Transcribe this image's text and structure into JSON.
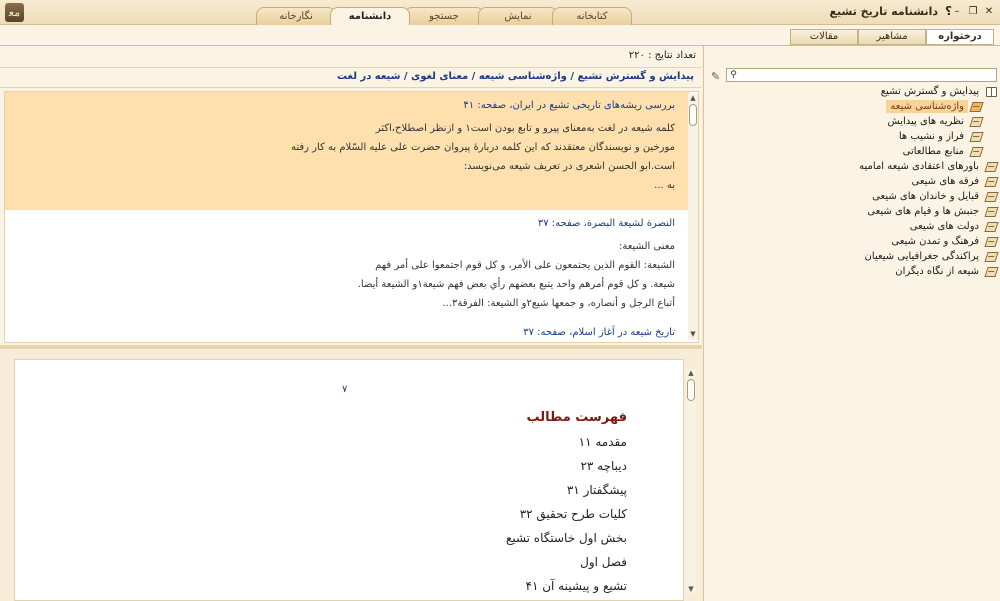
{
  "window": {
    "title": "دانشنامه تاریخ تشیع",
    "help": "؟",
    "minimize": "–",
    "restore": "❐",
    "close": "✕",
    "logo": "ﻣﻌ"
  },
  "main_tabs": [
    {
      "label": "کتابخانه",
      "active": false
    },
    {
      "label": "نمایش",
      "active": false
    },
    {
      "label": "جستجو",
      "active": false
    },
    {
      "label": "دانشنامه",
      "active": true
    },
    {
      "label": "نگارخانه",
      "active": false
    }
  ],
  "side_tabs": [
    {
      "label": "درختواره",
      "active": true
    },
    {
      "label": "مشاهیر",
      "active": false
    },
    {
      "label": "مقالات",
      "active": false
    }
  ],
  "result_count": "تعداد نتایج : ۲۲۰",
  "breadcrumb": "پیدایش و گسترش تشیع / واژه‌شناسی شیعه / معنای لغوی / شیعه در لغت",
  "results": [
    {
      "title": "بررسی ریشه‌های تاریخی تشیع در ایران، صفحه: ۴۱",
      "highlighted": true,
      "lines": [
        "کلمه شیعه در لغت به‌معنای پیرو و تابع بودن است۱ و ازنظر اصطلاح،اکثر",
        "مورخین و نویسندگان معتقدند که این کلمه دربارهٔ پیروان حضرت علی علیه السّلام به کار رفته",
        "است.ابو الحسن اشعری در تعریف شیعه می‌نویسد:",
        "به ..."
      ]
    },
    {
      "title": "النصرة لشیعة البصرة، صفحه: ۳۷",
      "highlighted": false,
      "lines": [
        "معنی الشیعة:",
        "الشیعة: القوم الذین یجتمعون علی الأمر، و کل قوم اجتمعوا علی أمر فهم",
        "شیعة. و کل قوم أمرهم واحد یتبع بعضهم رأي بعض فهم شیعة۱و الشیعة أیضا.",
        "أتباع الرجل و أنصاره، و جمعها شیع۲و الشیعة: الفرقة۳..."
      ]
    },
    {
      "title": "تاریخ شیعه در آغاز اسلام، صفحه: ۳۷",
      "highlighted": false,
      "lines": []
    }
  ],
  "document": {
    "page_number": "۷",
    "toc_title": "فهرست مطالب",
    "toc_items": [
      "مقدمه ۱۱",
      "دیباچه ۲۳",
      "پیشگفتار ۳۱",
      "کلیات طرح تحقیق ۳۲",
      "بخش اول خاستگاه تشیع",
      "فصل اول",
      "تشیع و پیشینه آن ۴۱"
    ]
  },
  "tree": {
    "search_placeholder": "",
    "items": [
      {
        "label": "پیدایش و گسترش تشیع",
        "level": 0,
        "icon": "open-book-icon",
        "selected": false
      },
      {
        "label": "واژه‌شناسی شیعه",
        "level": 1,
        "icon": "leaf-icon",
        "selected": true
      },
      {
        "label": "نظریه های پیدایش",
        "level": 1,
        "icon": "leaf-icon",
        "selected": false
      },
      {
        "label": "فراز و نشیب ها",
        "level": 1,
        "icon": "leaf-icon",
        "selected": false
      },
      {
        "label": "منابع مطالعاتی",
        "level": 1,
        "icon": "leaf-icon",
        "selected": false
      },
      {
        "label": "باورهای اعتقادی شیعه امامیه",
        "level": 0,
        "icon": "leaf-icon",
        "selected": false
      },
      {
        "label": "فرقه های شیعی",
        "level": 0,
        "icon": "leaf-icon",
        "selected": false
      },
      {
        "label": "قبایل و خاندان های شیعی",
        "level": 0,
        "icon": "leaf-icon",
        "selected": false
      },
      {
        "label": "جنبش ها و قیام های شیعی",
        "level": 0,
        "icon": "leaf-icon",
        "selected": false
      },
      {
        "label": "دولت های شیعی",
        "level": 0,
        "icon": "leaf-icon",
        "selected": false
      },
      {
        "label": "فرهنگ و تمدن شیعی",
        "level": 0,
        "icon": "leaf-icon",
        "selected": false
      },
      {
        "label": "پراکندگی جغرافیایی شیعیان",
        "level": 0,
        "icon": "leaf-icon",
        "selected": false
      },
      {
        "label": "شیعه از نگاه دیگران",
        "level": 0,
        "icon": "leaf-icon",
        "selected": false
      }
    ]
  },
  "colors": {
    "accent": "#1b3a86",
    "highlight": "#fde0ad",
    "toc_title": "#7a1a10",
    "tree_selected": "#f8d39a"
  }
}
